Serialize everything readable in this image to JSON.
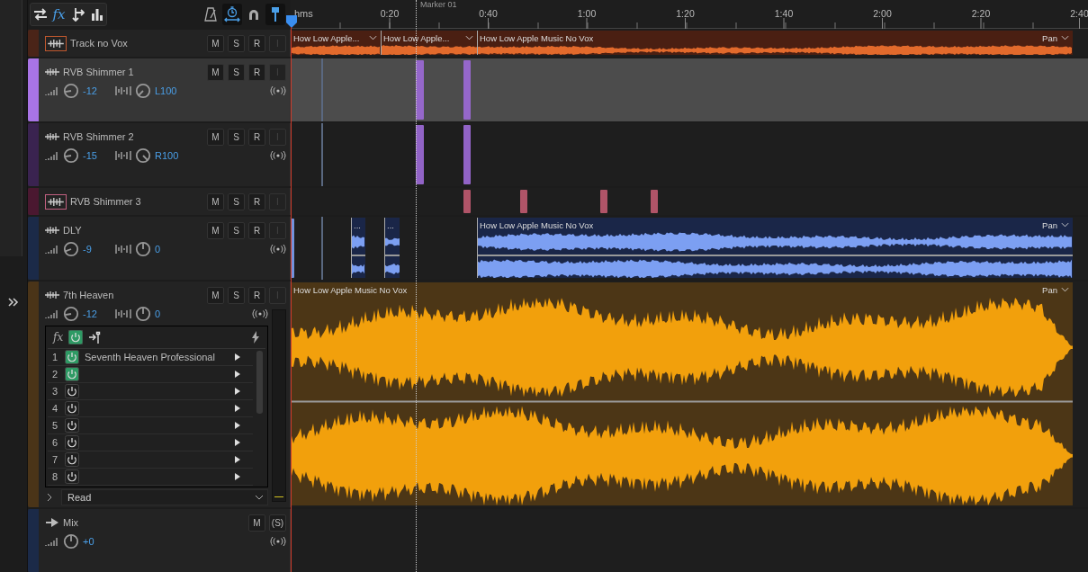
{
  "toolbar": {
    "left": [
      {
        "kind": "swap",
        "selected": false
      },
      {
        "kind": "fx",
        "label": "fx",
        "selected": true
      },
      {
        "kind": "route",
        "selected": false
      },
      {
        "kind": "bars",
        "selected": false
      }
    ],
    "right": [
      {
        "kind": "metronome",
        "selected": false
      },
      {
        "kind": "timer",
        "selected": true
      },
      {
        "kind": "magnet",
        "selected": false
      },
      {
        "kind": "pin",
        "selected": true
      }
    ]
  },
  "ruler": {
    "unit": "hms",
    "ticks": [
      "0:20",
      "0:40",
      "1:00",
      "1:20",
      "1:40",
      "2:00",
      "2:20",
      "2:40"
    ],
    "marker": "Marker 01"
  },
  "tracks": [
    {
      "kind": "compact",
      "name": "Track no Vox",
      "color": "#4a2418",
      "selected": false,
      "buttons": [
        {
          "label": "M",
          "disabled": false
        },
        {
          "label": "S",
          "disabled": false
        },
        {
          "label": "R",
          "disabled": false
        },
        {
          "label": "I",
          "disabled": true
        }
      ],
      "clips": [
        {
          "title": "How Low Apple..."
        },
        {
          "title": "How Low Apple..."
        },
        {
          "title": "How Low Apple Music No Vox",
          "menu": "Pan"
        }
      ]
    },
    {
      "kind": "expanded",
      "name": "RVB Shimmer 1",
      "color": "#a974e6",
      "selected": true,
      "buttons": [
        {
          "label": "M",
          "disabled": false
        },
        {
          "label": "S",
          "disabled": false
        },
        {
          "label": "R",
          "disabled": false
        },
        {
          "label": "I",
          "disabled": true
        }
      ],
      "volume": "-12",
      "pan": "L100"
    },
    {
      "kind": "expanded",
      "name": "RVB Shimmer 2",
      "color": "#3a2350",
      "selected": false,
      "buttons": [
        {
          "label": "M",
          "disabled": false
        },
        {
          "label": "S",
          "disabled": false
        },
        {
          "label": "R",
          "disabled": false
        },
        {
          "label": "I",
          "disabled": true
        }
      ],
      "volume": "-15",
      "pan": "R100"
    },
    {
      "kind": "compact",
      "name": "RVB Shimmer 3",
      "color": "#4a1830",
      "selected": false,
      "buttons": [
        {
          "label": "M",
          "disabled": false
        },
        {
          "label": "S",
          "disabled": false
        },
        {
          "label": "R",
          "disabled": false
        },
        {
          "label": "I",
          "disabled": true
        }
      ]
    },
    {
      "kind": "expanded",
      "name": "DLY",
      "color": "#1b2a48",
      "selected": false,
      "buttons": [
        {
          "label": "M",
          "disabled": false
        },
        {
          "label": "S",
          "disabled": false
        },
        {
          "label": "R",
          "disabled": false
        },
        {
          "label": "I",
          "disabled": true
        }
      ],
      "volume": "-9",
      "pan": "0",
      "clips": [
        {
          "title": "..."
        },
        {
          "title": "..."
        },
        {
          "title": "How Low Apple Music No Vox",
          "menu": "Pan"
        }
      ]
    },
    {
      "kind": "fx",
      "name": "7th Heaven",
      "color": "#4a3418",
      "selected": false,
      "buttons": [
        {
          "label": "M",
          "disabled": false
        },
        {
          "label": "S",
          "disabled": false
        },
        {
          "label": "R",
          "disabled": false
        },
        {
          "label": "I",
          "disabled": true
        }
      ],
      "volume": "-12",
      "pan": "0",
      "clips": [
        {
          "title": "How Low Apple Music No Vox",
          "menu": "Pan"
        }
      ],
      "fx": {
        "label": "fx",
        "on": true,
        "slots": [
          {
            "number": "1",
            "name": "Seventh Heaven Professional",
            "on": true
          },
          {
            "number": "2",
            "on": true
          },
          {
            "number": "3",
            "on": false
          },
          {
            "number": "4",
            "on": false
          },
          {
            "number": "5",
            "on": false
          },
          {
            "number": "6",
            "on": false
          },
          {
            "number": "7",
            "on": false
          },
          {
            "number": "8",
            "on": false
          }
        ]
      },
      "automation": "Read"
    },
    {
      "kind": "master",
      "name": "Mix",
      "color": "#1b2a48",
      "selected": false,
      "buttons": [
        {
          "label": "M",
          "disabled": false
        },
        {
          "label": "(S)",
          "disabled": false
        }
      ],
      "volume": "+0"
    }
  ]
}
